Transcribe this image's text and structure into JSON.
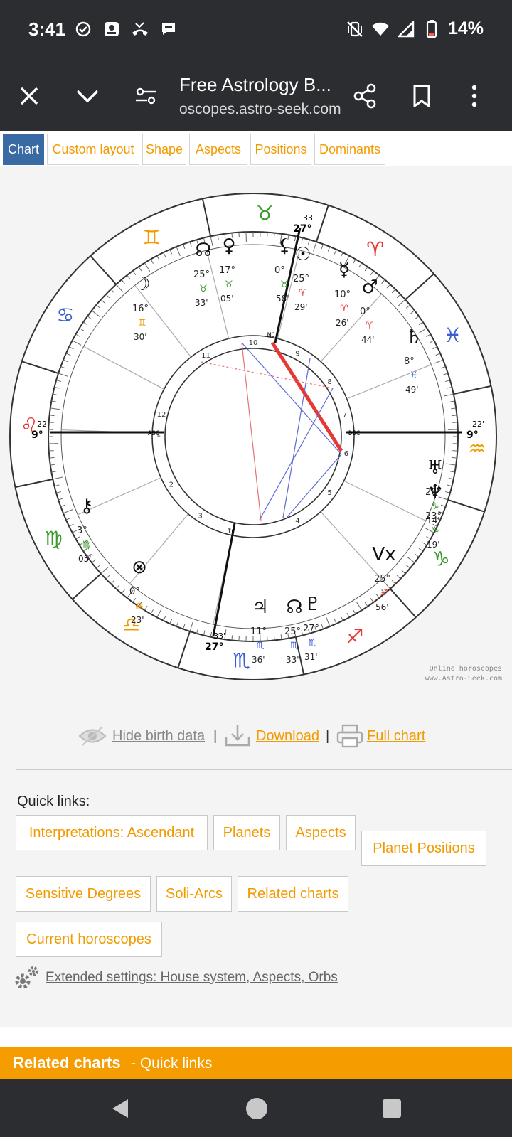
{
  "status_bar": {
    "time": "3:41",
    "battery": "14%",
    "icons": [
      "check-circle-icon",
      "assistant-icon",
      "missed-call-icon",
      "message-icon",
      "vibrate-off-icon",
      "wifi-icon",
      "signal-icon",
      "battery-low-icon"
    ]
  },
  "app_bar": {
    "title": "Free Astrology B...",
    "url": "oscopes.astro-seek.com",
    "icons": [
      "close-icon",
      "chevron-down-icon",
      "page-settings-icon",
      "share-icon",
      "bookmark-icon",
      "more-vert-icon"
    ]
  },
  "tabs": [
    {
      "label": "Chart",
      "active": true
    },
    {
      "label": "Custom layout",
      "active": false
    },
    {
      "label": "Shape",
      "active": false
    },
    {
      "label": "Aspects",
      "active": false
    },
    {
      "label": "Positions",
      "active": false
    },
    {
      "label": "Dominants",
      "active": false
    }
  ],
  "chart": {
    "signs": [
      "♉",
      "♈",
      "♓",
      "♒",
      "♑",
      "♐",
      "♏",
      "♎",
      "♍",
      "♌",
      "♋",
      "♊"
    ],
    "sign_colors": [
      "#3a9a2a",
      "#e53935",
      "#3b5ed6",
      "#f29b00",
      "#3a9a2a",
      "#e53935",
      "#3b5ed6",
      "#f29b00",
      "#3a9a2a",
      "#e53935",
      "#3b5ed6",
      "#f29b00"
    ],
    "asc_left_deg": "9°",
    "asc_left_min": "22'",
    "dsc_right_deg": "9°",
    "dsc_right_min": "22'",
    "mc_deg": "27°",
    "mc_min": "33'",
    "ic_deg": "27°",
    "ic_min": "33'",
    "house_numbers": [
      "10",
      "9",
      "8",
      "7",
      "6",
      "5",
      "4",
      "3",
      "2",
      "1",
      "12",
      "11"
    ],
    "axis_labels": {
      "asc": "ASC",
      "dsc": "DSC",
      "mc": "MC",
      "ic": "IC"
    },
    "planets": [
      {
        "glyph": "☊",
        "deg": "25°",
        "sign": "♉",
        "min": "33'"
      },
      {
        "glyph": "♀",
        "deg": "17°",
        "sign": "♉",
        "min": "05'"
      },
      {
        "glyph": "⚸",
        "deg": "0°",
        "sign": "♉",
        "min": "58'"
      },
      {
        "glyph": "☉",
        "deg": "25°",
        "sign": "♈",
        "min": "29'"
      },
      {
        "glyph": "☿",
        "deg": "10°",
        "sign": "♈",
        "min": "26'"
      },
      {
        "glyph": "♂",
        "deg": "0°",
        "sign": "♈",
        "min": "44'"
      },
      {
        "glyph": "☽",
        "deg": "16°",
        "sign": "♊",
        "min": "30'"
      },
      {
        "glyph": "♄",
        "deg": "8°",
        "sign": "♓",
        "min": "49'"
      },
      {
        "glyph": "♅",
        "deg": "26°",
        "sign": "♑",
        "min": "14'"
      },
      {
        "glyph": "♆",
        "deg": "23°",
        "sign": "♑",
        "min": "19'"
      },
      {
        "glyph": "⚷",
        "deg": "3°",
        "sign": "♍",
        "min": "05'"
      },
      {
        "glyph": "⊗",
        "deg": "0°",
        "sign": "♎",
        "min": "23'"
      },
      {
        "glyph": "Vx",
        "deg": "25°",
        "sign": "♐",
        "min": "56'"
      },
      {
        "glyph": "♃",
        "deg": "11°",
        "sign": "♏",
        "min": "36'"
      },
      {
        "glyph": "☊",
        "deg": "25°",
        "sign": "♏",
        "min": "33'"
      },
      {
        "glyph": "♇",
        "deg": "27°",
        "sign": "♏",
        "min": "31'"
      }
    ],
    "credit_line1": "Online horoscopes",
    "credit_line2": "www.Astro-Seek.com"
  },
  "actions": {
    "hide_birth_data": "Hide birth data",
    "download": "Download",
    "full_chart": "Full chart",
    "separator": "|"
  },
  "quick_links": {
    "title": "Quick links:",
    "items": [
      "Interpretations: Ascendant",
      "Planets",
      "Aspects",
      "Planet Positions",
      "Sensitive Degrees",
      "Soli-Arcs",
      "Related charts",
      "Current horoscopes"
    ],
    "extended_settings": "Extended settings: House system, Aspects, Orbs"
  },
  "related_bar": {
    "bold": "Related charts",
    "sub": "- Quick links"
  },
  "colors": {
    "accent_orange": "#f29b00",
    "tab_blue": "#3a6aa3",
    "dark_bar": "#2b2d31",
    "aspect_red": "#e53935",
    "aspect_blue": "#4a5ae0"
  }
}
